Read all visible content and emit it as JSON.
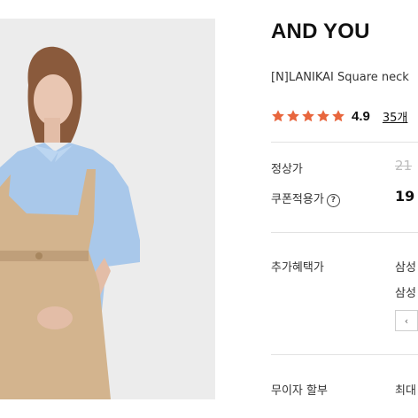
{
  "product": {
    "brand": "AND YOU",
    "name": "[N]LANIKAI Square neck",
    "rating": "4.9",
    "review_count": "35개",
    "star_color": "#e8663d",
    "image_icon": "product-photo"
  },
  "pricing": {
    "regular_label": "정상가",
    "regular_value": "21",
    "coupon_label": "쿠폰적용가",
    "coupon_help_icon": "?",
    "coupon_value": "19"
  },
  "benefits": {
    "label": "추가혜택가",
    "items": [
      "삼성",
      "삼성"
    ],
    "prev_button": "‹"
  },
  "installment": {
    "label": "무이자 할부",
    "value": "최대"
  }
}
